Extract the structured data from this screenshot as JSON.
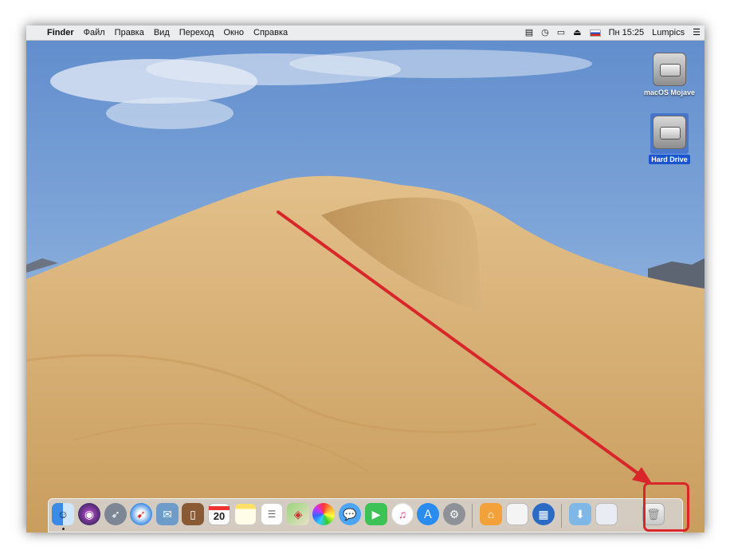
{
  "menubar": {
    "apple_glyph": "",
    "app_name": "Finder",
    "menus": [
      "Файл",
      "Правка",
      "Вид",
      "Переход",
      "Окно",
      "Справка"
    ],
    "clock": "Пн 15:25",
    "user": "Lumpics",
    "status_icons": [
      "mission-control-icon",
      "time-machine-icon",
      "airplay-display-icon",
      "eject-icon",
      "russian-flag-input-icon",
      "list-menu-icon"
    ]
  },
  "desktop": {
    "icons": [
      {
        "label": "macOS Mojave",
        "icon": "internal-drive-icon",
        "selected": false
      },
      {
        "label": "Hard Drive",
        "icon": "internal-drive-icon",
        "selected": true
      }
    ]
  },
  "dock": {
    "apps": [
      {
        "name": "finder-icon"
      },
      {
        "name": "siri-icon"
      },
      {
        "name": "launchpad-icon"
      },
      {
        "name": "safari-icon"
      },
      {
        "name": "mail-icon"
      },
      {
        "name": "contacts-icon"
      },
      {
        "name": "calendar-icon",
        "text": "20"
      },
      {
        "name": "notes-icon"
      },
      {
        "name": "reminders-icon"
      },
      {
        "name": "maps-icon"
      },
      {
        "name": "photos-icon"
      },
      {
        "name": "messages-icon"
      },
      {
        "name": "facetime-icon"
      },
      {
        "name": "itunes-icon"
      },
      {
        "name": "app-store-icon"
      },
      {
        "name": "system-preferences-icon"
      },
      {
        "name": "home-icon"
      },
      {
        "name": "document-icon"
      },
      {
        "name": "migration-assistant-icon"
      },
      {
        "name": "downloads-folder-icon"
      },
      {
        "name": "screenshot-stack-icon"
      },
      {
        "name": "trash-icon"
      }
    ]
  },
  "colors": {
    "accent_red": "#d8262a",
    "selection_blue": "#1a55d0",
    "sky": "#6f98d2",
    "sand": "#d9b47a"
  }
}
